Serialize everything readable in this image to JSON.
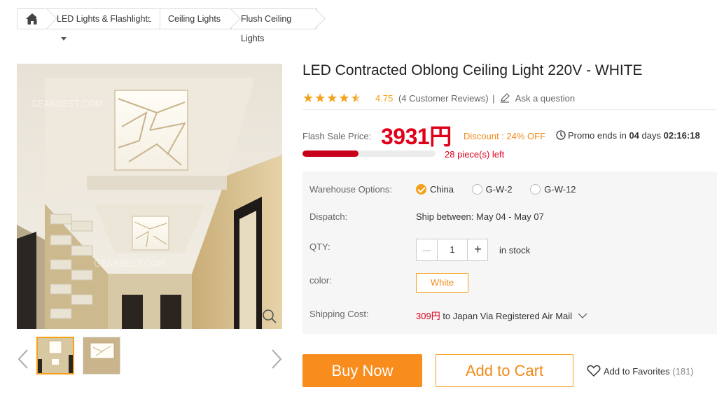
{
  "breadcrumb": {
    "items": [
      {
        "label": "LED Lights & Flashlights"
      },
      {
        "label": "Ceiling Lights"
      },
      {
        "label": "Flush Ceiling Lights"
      }
    ]
  },
  "product": {
    "title": "LED Contracted Oblong Ceiling Light 220V - WHITE",
    "rating_value": 4.5,
    "rating_text": "4.75",
    "reviews_text": "(4 Customer Reviews)",
    "separator": "|",
    "ask_question": "Ask a question",
    "watermark": "GEARBEST.COM"
  },
  "pricing": {
    "flash_label": "Flash Sale Price:",
    "price": "3931円",
    "discount": "Discount : 24% OFF",
    "promo_prefix": "Promo ends in",
    "promo_days": "04",
    "promo_days_label": "days",
    "promo_time": "02:16:18",
    "stock_left": "28 piece(s) left",
    "stock_progress": 0.42
  },
  "options": {
    "warehouse_label": "Warehouse Options:",
    "warehouses": [
      {
        "label": "China",
        "selected": true
      },
      {
        "label": "G-W-2",
        "selected": false
      },
      {
        "label": "G-W-12",
        "selected": false
      }
    ],
    "dispatch_label": "Dispatch:",
    "dispatch_value": "Ship between: May 04 - May 07",
    "qty_label": "QTY:",
    "qty_value": "1",
    "qty_minus": "—",
    "qty_plus": "+",
    "in_stock": "in stock",
    "color_label": "color:",
    "color_value": "White",
    "shipping_label": "Shipping Cost:",
    "shipping_price": "309円",
    "shipping_text": " to Japan Via Registered Air Mail"
  },
  "actions": {
    "buy_now": "Buy Now",
    "add_to_cart": "Add to Cart",
    "favorites": "Add to Favorites",
    "favorites_count": "(181)"
  },
  "colors": {
    "accent": "#f6a01a",
    "price_red": "#e0001a",
    "buy_button": "#f88c1c"
  }
}
